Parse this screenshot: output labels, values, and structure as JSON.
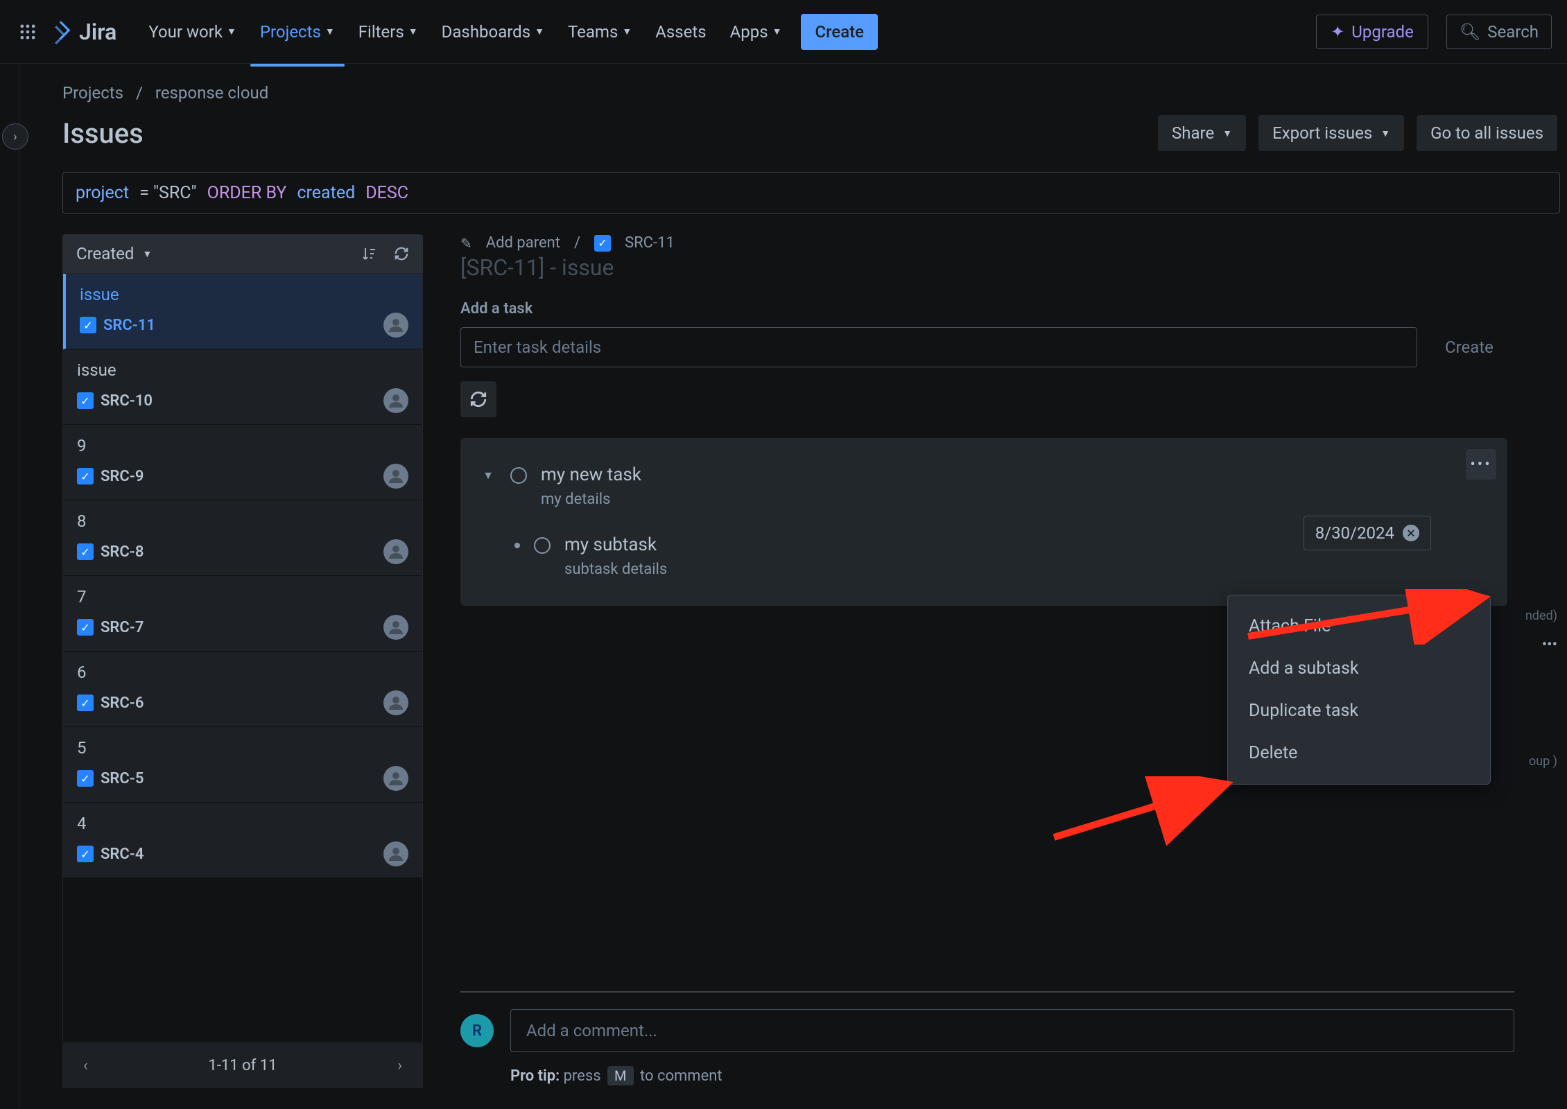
{
  "nav": {
    "product": "Jira",
    "items": [
      "Your work",
      "Projects",
      "Filters",
      "Dashboards",
      "Teams",
      "Assets",
      "Apps"
    ],
    "active_index": 1,
    "create": "Create",
    "upgrade": "Upgrade",
    "search_placeholder": "Search"
  },
  "breadcrumb": {
    "root": "Projects",
    "project": "response cloud"
  },
  "page_title": "Issues",
  "header_actions": {
    "share": "Share",
    "export": "Export issues",
    "goto": "Go to all issues"
  },
  "jql": {
    "field": "project",
    "op": "=",
    "value": "\"SRC\"",
    "order": "ORDER BY",
    "col": "created",
    "dir": "DESC"
  },
  "issue_list": {
    "sort_label": "Created",
    "items": [
      {
        "summary": "issue",
        "key": "SRC-11",
        "selected": true
      },
      {
        "summary": "issue",
        "key": "SRC-10",
        "selected": false
      },
      {
        "summary": "9",
        "key": "SRC-9",
        "selected": false
      },
      {
        "summary": "8",
        "key": "SRC-8",
        "selected": false
      },
      {
        "summary": "7",
        "key": "SRC-7",
        "selected": false
      },
      {
        "summary": "6",
        "key": "SRC-6",
        "selected": false
      },
      {
        "summary": "5",
        "key": "SRC-5",
        "selected": false
      },
      {
        "summary": "4",
        "key": "SRC-4",
        "selected": false
      }
    ],
    "pager": "1-11 of 11"
  },
  "detail": {
    "add_parent": "Add parent",
    "key": "SRC-11",
    "title_ghost": "[SRC-11] - issue",
    "add_task_label": "Add a task",
    "add_task_placeholder": "Enter task details",
    "create_task_btn": "Create",
    "task": {
      "title": "my new task",
      "details": "my details",
      "date": "8/30/2024",
      "subtask_title": "my subtask",
      "subtask_details": "subtask details"
    }
  },
  "context_menu": {
    "items": [
      "Attach File",
      "Add a subtask",
      "Duplicate task",
      "Delete"
    ]
  },
  "comment": {
    "avatar_initial": "R",
    "placeholder": "Add a comment...",
    "pro_tip_label": "Pro tip:",
    "pro_tip_text_before": " press ",
    "pro_tip_key": "M",
    "pro_tip_text_after": " to comment"
  },
  "side_fragments": {
    "a": "nded)",
    "b": "oup )"
  }
}
